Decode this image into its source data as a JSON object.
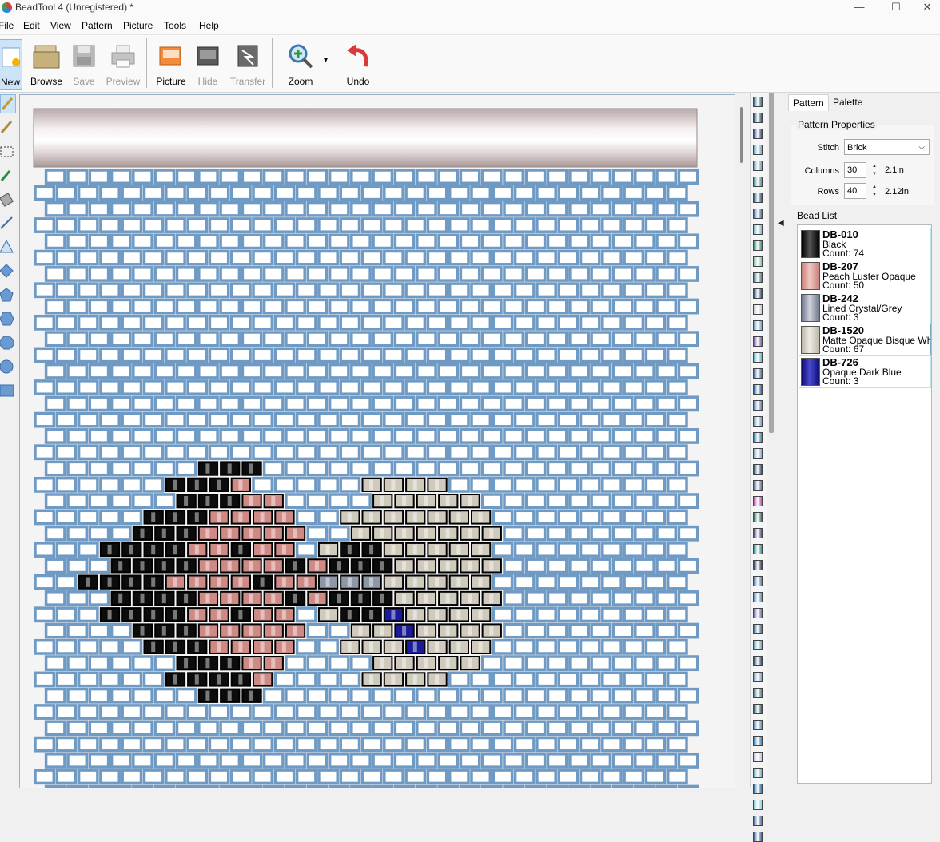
{
  "window": {
    "title": "BeadTool 4 (Unregistered) *",
    "minimize": "—",
    "maximize": "☐",
    "close": "✕"
  },
  "menu": [
    "File",
    "Edit",
    "View",
    "Pattern",
    "Picture",
    "Tools",
    "Help"
  ],
  "toolbar": {
    "new": "New",
    "browse": "Browse",
    "save": "Save",
    "preview": "Preview",
    "picture": "Picture",
    "hide": "Hide",
    "transfer": "Transfer",
    "zoom": "Zoom",
    "zoom_dropdown": "▾",
    "undo": "Undo"
  },
  "tools": [
    "pencil-icon",
    "brush-icon",
    "select-rect-icon",
    "eyedropper-icon",
    "fill-bucket-icon",
    "line-icon",
    "triangle-icon",
    "diamond-icon",
    "pentagon-icon",
    "hexagon-icon",
    "octagon-icon",
    "circle-icon",
    "rectangle-icon"
  ],
  "tabs": {
    "pattern": "Pattern",
    "palette": "Palette"
  },
  "properties": {
    "title": "Pattern Properties",
    "stitch_label": "Stitch",
    "stitch_value": "Brick",
    "columns_label": "Columns",
    "columns_value": "30",
    "columns_unit": "2.1in",
    "rows_label": "Rows",
    "rows_value": "40",
    "rows_unit": "2.12in"
  },
  "bead_list": {
    "title": "Bead List",
    "items": [
      {
        "code": "DB-010",
        "name": "Black",
        "count": "Count: 74",
        "color": "#0c0c0c"
      },
      {
        "code": "DB-207",
        "name": "Peach Luster Opaque",
        "count": "Count: 50",
        "color": "#d99892"
      },
      {
        "code": "DB-242",
        "name": "Lined Crystal/Grey",
        "count": "Count: 3",
        "color": "#8f96a8"
      },
      {
        "code": "DB-1520",
        "name": "Matte Opaque Bisque White",
        "count": "Count: 67",
        "color": "#d4d0c4"
      },
      {
        "code": "DB-726",
        "name": "Opaque Dark Blue",
        "count": "Count: 3",
        "color": "#1a1a9a"
      }
    ]
  },
  "colors": {
    "empty_bead": "#ffffff",
    "bead_border": "#6f9ac4",
    "black": "#0c0c0c",
    "peach": "#d08a86",
    "grey": "#8f96a8",
    "bisque": "#cfcabc",
    "blue": "#1a1a9a"
  },
  "strip_colors": [
    "#3b6d86",
    "#2e5a6e",
    "#3b4f88",
    "#6aa6c4",
    "#6f9bb2",
    "#4f8f98",
    "#2f5e7d",
    "#4a6f9e",
    "#7fb8c8",
    "#3e8a7e",
    "#86c3a4",
    "#4d7f8c",
    "#2e4f7a",
    "#c8c8d8",
    "#6fa0c8",
    "#7a5aa8",
    "#5fb8c8",
    "#4a6e9e",
    "#2f5f98",
    "#5a7fb0",
    "#6e9eb8",
    "#3f7ea8",
    "#8aa8c8",
    "#2f4f6f",
    "#5f6f9e",
    "#c050b0",
    "#2f6e6a",
    "#4e4e7e",
    "#3e8e8e",
    "#2f3f5f",
    "#4f7faf",
    "#5f8fbf",
    "#6e6eae",
    "#3e6e8e",
    "#6aa8b8",
    "#2f4e6e",
    "#7f9fbf",
    "#4e7e8e",
    "#2e5e6e",
    "#5e8ebe",
    "#3e7eae",
    "#c8c0e0",
    "#6eaebe",
    "#2f6f9f",
    "#8ecedf",
    "#4e6e9e",
    "#3f5f8f"
  ],
  "pattern": {
    "rows": [
      "",
      "",
      " ",
      "",
      "",
      "",
      "",
      "",
      "",
      "",
      "",
      "",
      "",
      "",
      "",
      "",
      "",
      "",
      "",
      "",
      "",
      "",
      "",
      "",
      "",
      "",
      "",
      "",
      "",
      "",
      "",
      "",
      "",
      "",
      "",
      "",
      "",
      "",
      "",
      ""
    ],
    "cells": [
      "..............................",
      "..............................",
      "..............................",
      "..............................",
      "..............................",
      "..............................",
      "..............................",
      "..............................",
      "..............................",
      "..............................",
      "..............................",
      "..............................",
      "..............................",
      "..............................",
      "..............................",
      "..............................",
      "..............................",
      "..............................",
      ".......KKK....................",
      "......KKKP.....WWWW...........",
      "......KKKPP....WWWWW..........",
      ".....KKKPPPP..WWWWWWW.........",
      "....KKKPPPPP..WWWWWWW.........",
      "...KKKKPPKPP.WKKWWWWW.........",
      "...KKKKPPPPKPKKKWWWWW.........",
      "..KKKKPPPPKPPGGGWWWWW.........",
      "...KKKKPPPPKPKKKWWWWW.........",
      "...KKKKPPKPP.WKKBWWWW.........",
      "....KKKPPPPP..WWBWWWW.........",
      ".....KKKPPPP..WWWBWWW.........",
      "......KKKPP....WWWWW..........",
      "......KKKKP....WWWW...........",
      ".......KKK....................",
      "..............................",
      "..............................",
      "..............................",
      "..............................",
      "..............................",
      "..............................",
      ".............................."
    ]
  }
}
